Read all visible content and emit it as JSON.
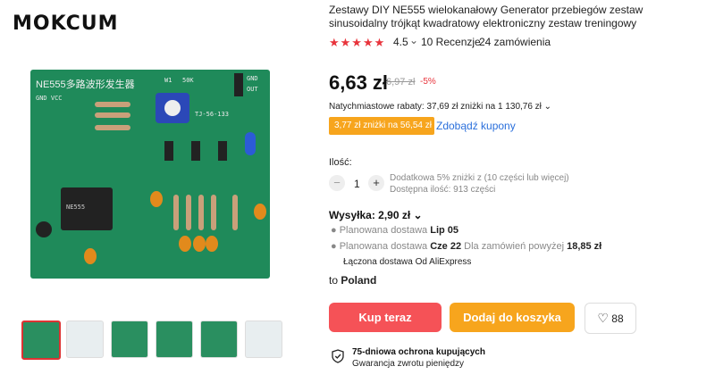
{
  "brand": {
    "logo": "MOKCUM"
  },
  "product": {
    "title": "Zestawy DIY NE555 wielokanałowy Generator przebiegów zestaw sinusoidalny trójkąt kwadratowy elektroniczny zestaw treningowy",
    "stars": "★★★★★",
    "rating": "4.5",
    "rating_caret": "⌄",
    "reviews": "10 Recenzje",
    "orders": "24 zamówienia",
    "price": "6,63 zł",
    "old_price": "6,97 zł",
    "discount": "-5%",
    "instant_discount": "Natychmiastowe rabaty: 37,69 zł zniżki na 1 130,76 zł ⌄",
    "coupon": "3,77 zł zniżki na 56,54 zł",
    "coupon_link": "Zdobądź kupony"
  },
  "image": {
    "board_title": "NE555多路波形发生器",
    "labels": {
      "gnd_vcc": "GND VCC",
      "w1": "W1",
      "k50": "50K",
      "gnd": "GND",
      "out": "OUT",
      "tj": "TJ-56-133",
      "ne555": "NE555"
    },
    "thumb_count": 6
  },
  "quantity": {
    "label": "Ilość:",
    "minus": "−",
    "value": "1",
    "plus": "+",
    "extra_discount": "Dodatkowa 5% zniżki z (10 części lub więcej)",
    "available": "Dostępna ilość: 913 części"
  },
  "shipping": {
    "title": "Wysyłka: 2,90 zł ⌄",
    "line1_prefix": "Planowana dostawa ",
    "line1_date": "Lip 05",
    "line2_prefix": "Planowana dostawa ",
    "line2_date": "Cze 22",
    "line2_mid": " Dla zamówień powyżej ",
    "line2_amount": "18,85 zł",
    "combined": "Łączona dostawa  Od AliExpress",
    "dest_prefix": "to ",
    "dest_country": "Poland"
  },
  "actions": {
    "buy_now": "Kup teraz",
    "add_to_cart": "Dodaj do koszyka",
    "wishlist_count": "88"
  },
  "protection": {
    "title": "75-dniowa ochrona kupujących",
    "subtitle": "Gwarancja zwrotu pieniędzy"
  },
  "colors": {
    "accent_red": "#e8343c",
    "coupon_orange": "#f7a51d",
    "link_blue": "#2a6fdb",
    "pcb_green": "#1f8a5a"
  }
}
